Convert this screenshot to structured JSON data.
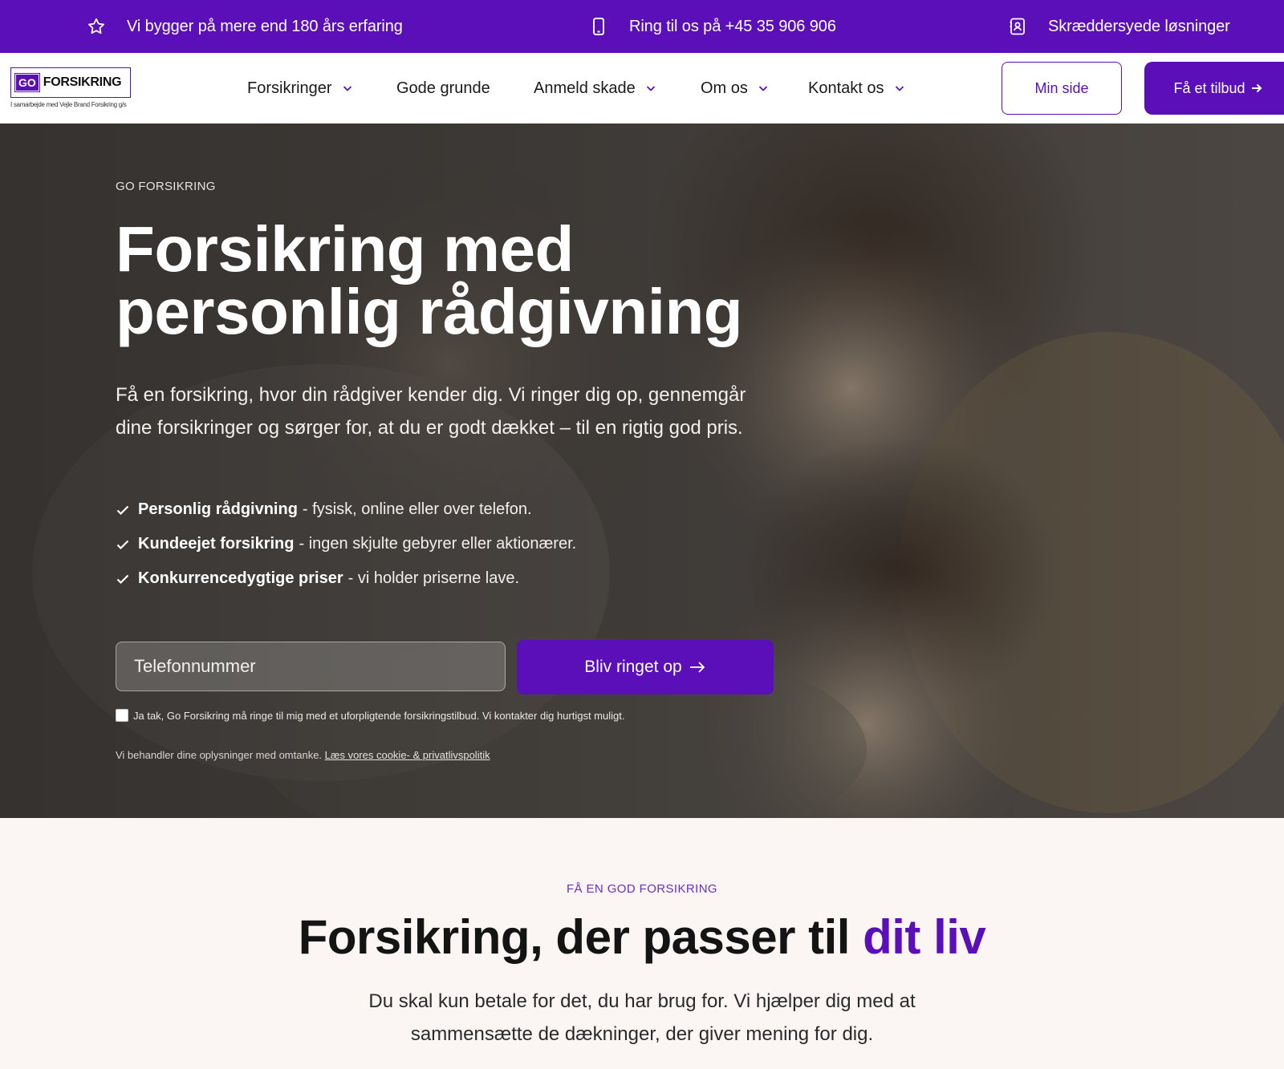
{
  "topbar": {
    "items": [
      {
        "icon": "star-icon",
        "text": "Vi bygger på mere end 180 års erfaring"
      },
      {
        "icon": "mobile-phone-icon",
        "text": "Ring til os på +45 35 906 906"
      },
      {
        "icon": "contact-card-icon",
        "text": "Skræddersyede løsninger"
      }
    ]
  },
  "header": {
    "logo": {
      "go": "GO",
      "name": "FORSIKRING",
      "tagline": "I samarbejde med Vejle Brand Forsikring g/s"
    },
    "nav": [
      {
        "label": "Forsikringer",
        "has_dropdown": true
      },
      {
        "label": "Gode grunde",
        "has_dropdown": false
      },
      {
        "label": "Anmeld skade",
        "has_dropdown": true
      },
      {
        "label": "Om os",
        "has_dropdown": true
      },
      {
        "label": "Kontakt os",
        "has_dropdown": true
      }
    ],
    "min_side": "Min side",
    "tilbud": "Få et tilbud"
  },
  "hero": {
    "eyebrow": "GO FORSIKRING",
    "title_line1": "Forsikring med",
    "title_line2": "personlig rådgivning",
    "lead": "Få en forsikring, hvor din rådgiver kender dig. Vi ringer dig op, gennemgår dine forsikringer og sørger for, at du er godt dækket – til en rigtig god pris.",
    "checks": [
      {
        "bold": "Personlig rådgivning",
        "text": "- fysisk, online eller over telefon."
      },
      {
        "bold": "Kundeejet forsikring",
        "text": "- ingen skjulte gebyrer eller aktionærer."
      },
      {
        "bold": "Konkurrencedygtige priser",
        "text": "- vi holder priserne lave."
      }
    ],
    "phone_placeholder": "Telefonnummer",
    "call_button": "Bliv ringet op",
    "consent": "Ja tak, Go Forsikring må ringe til mig med et uforpligtende forsikringstilbud. Vi kontakter dig hurtigst muligt.",
    "privacy_text": "Vi behandler dine oplysninger med omtanke.",
    "privacy_link": "Læs vores cookie- & privatlivspolitik"
  },
  "section": {
    "eyebrow": "FÅ EN GOD FORSIKRING",
    "title_main": "Forsikring, der passer til ",
    "title_accent": "dit liv",
    "text": "Du skal kun betale for det, du har brug for. Vi hjælper dig med at sammensætte de dækninger, der giver mening for dig."
  },
  "colors": {
    "brand": "#5b0fb8",
    "background": "#fbf6f4"
  }
}
